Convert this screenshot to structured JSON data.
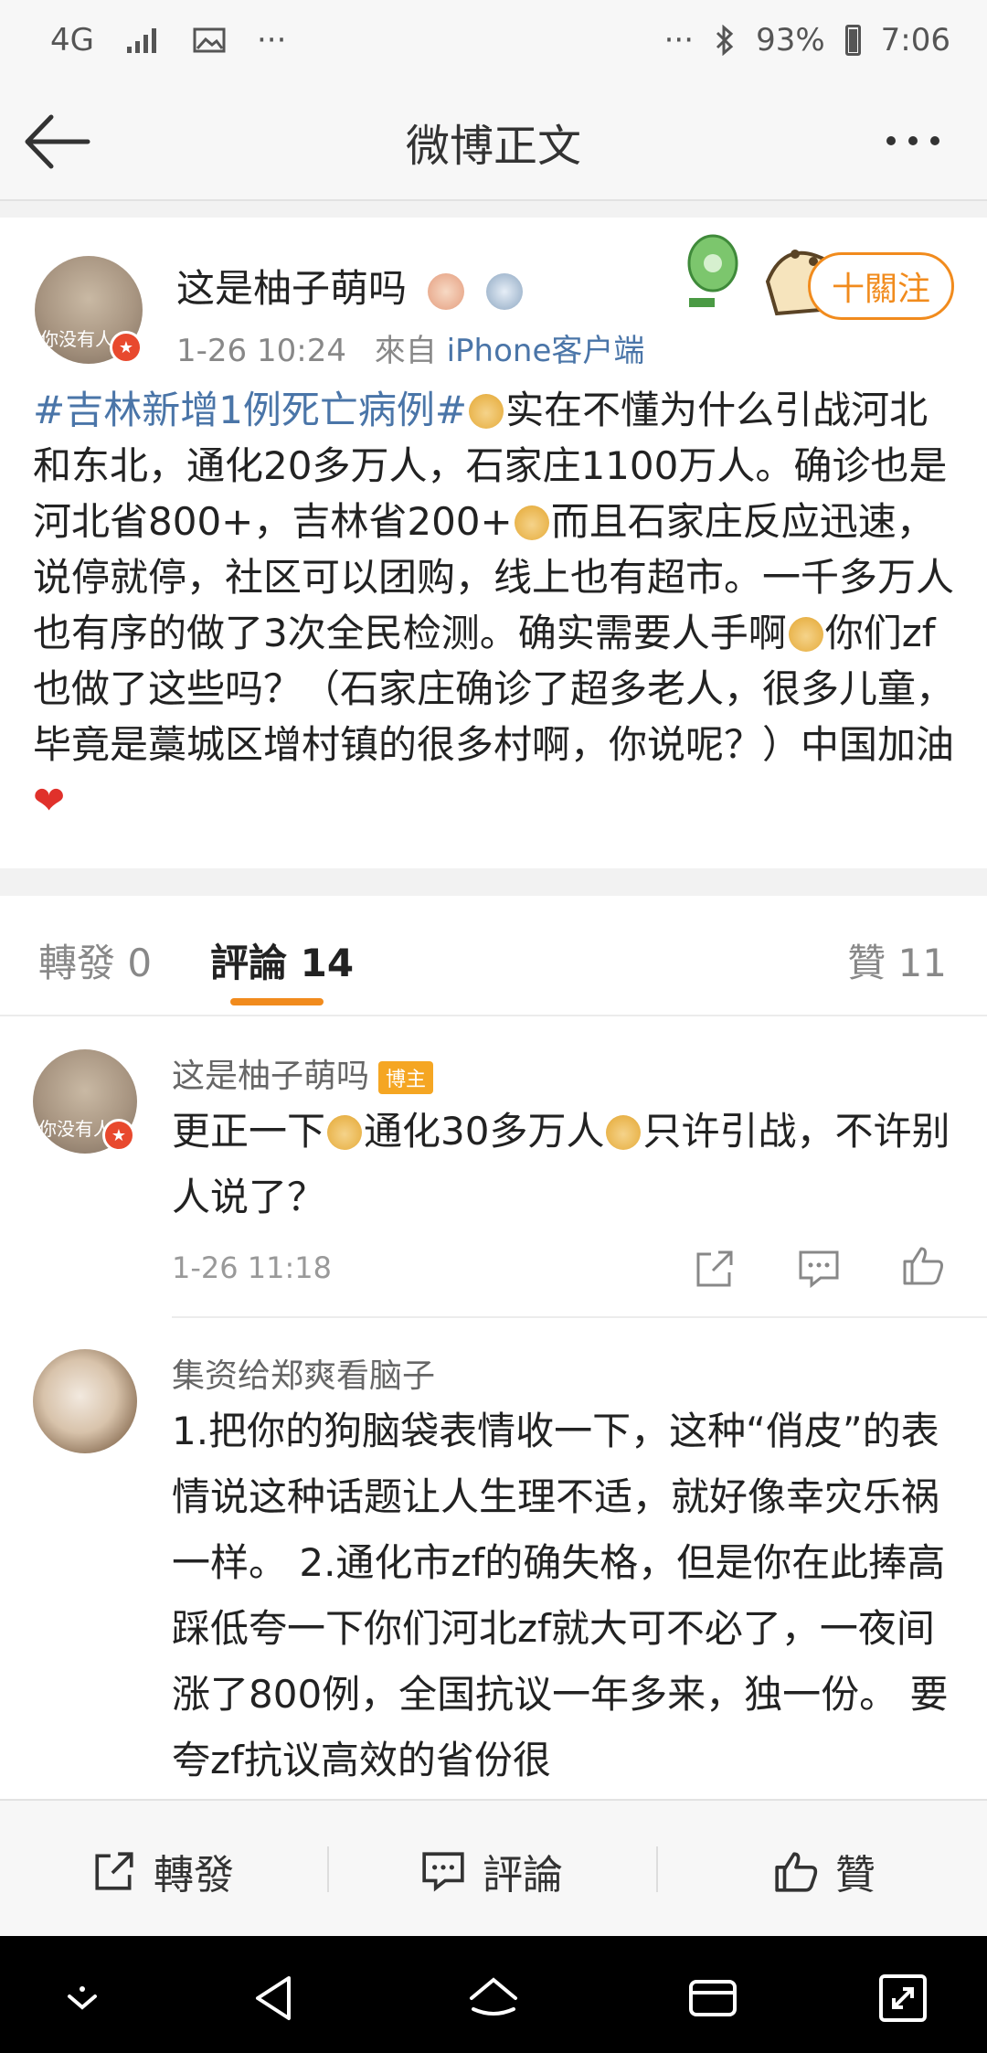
{
  "status_bar": {
    "network": "4G",
    "more_left": "···",
    "more_right": "···",
    "battery": "93%",
    "time": "7:06"
  },
  "nav": {
    "title": "微博正文"
  },
  "post": {
    "author": "这是柚子萌吗",
    "avatar_caption": "你没有人",
    "date": "1-26 10:24",
    "source_prefix": "來自",
    "source": "iPhone客户端",
    "follow_label": "十關注",
    "hashtag": "#吉林新增1例死亡病例#",
    "body_1": "实在不懂为什么引战河北和东北，通化20多万人，石家庄1100万人。确诊也是河北省800+，吉林省200+",
    "body_2": "而且石家庄反应迅速，说停就停，社区可以团购，线上也有超市。一千多万人也有序的做了3次全民检测。确实需要人手啊",
    "body_3": "你们zf也做了这些吗？（石家庄确诊了超多老人，很多儿童，毕竟是藁城区增村镇的很多村啊，你说呢？）中国加油",
    "heart": "❤"
  },
  "tabs": {
    "repost": "轉發 0",
    "comment": "評論 14",
    "like": "贊 11"
  },
  "comments": [
    {
      "name": "这是柚子萌吗",
      "badge": "博主",
      "avatar_caption": "你没有人",
      "text_1": "更正一下",
      "text_2": "通化30多万人",
      "text_3": "只许引战，不许别人说了？",
      "time": "1-26 11:18"
    },
    {
      "name": "集资给郑爽看脑子",
      "text": "1.把你的狗脑袋表情收一下，这种“俏皮”的表情说这种话题让人生理不适，就好像幸灾乐祸一样。 2.通化市zf的确失格，但是你在此捧高踩低夸一下你们河北zf就大可不必了，一夜间涨了800例，全国抗议一年多来，独一份。 要夸zf抗议高效的省份很"
    }
  ],
  "actions": {
    "repost": "轉發",
    "comment": "評論",
    "like": "贊"
  },
  "colors": {
    "accent": "#f18b1d",
    "link": "#4a75a8",
    "host_badge": "#f5a623"
  }
}
